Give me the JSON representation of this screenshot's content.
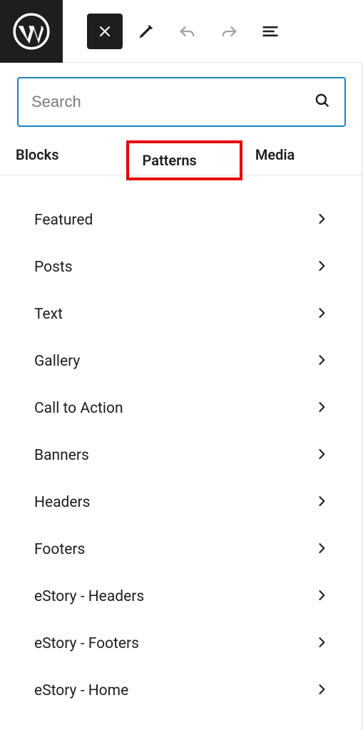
{
  "toolbar": {
    "close_label": "Close",
    "edit_label": "Edit",
    "undo_label": "Undo",
    "redo_label": "Redo",
    "details_label": "Details"
  },
  "search": {
    "placeholder": "Search"
  },
  "tabs": {
    "blocks": "Blocks",
    "patterns": "Patterns",
    "media": "Media"
  },
  "categories": [
    {
      "label": "Featured"
    },
    {
      "label": "Posts"
    },
    {
      "label": "Text"
    },
    {
      "label": "Gallery"
    },
    {
      "label": "Call to Action"
    },
    {
      "label": "Banners"
    },
    {
      "label": "Headers"
    },
    {
      "label": "Footers"
    },
    {
      "label": "eStory - Headers"
    },
    {
      "label": "eStory - Footers"
    },
    {
      "label": "eStory - Home"
    }
  ]
}
